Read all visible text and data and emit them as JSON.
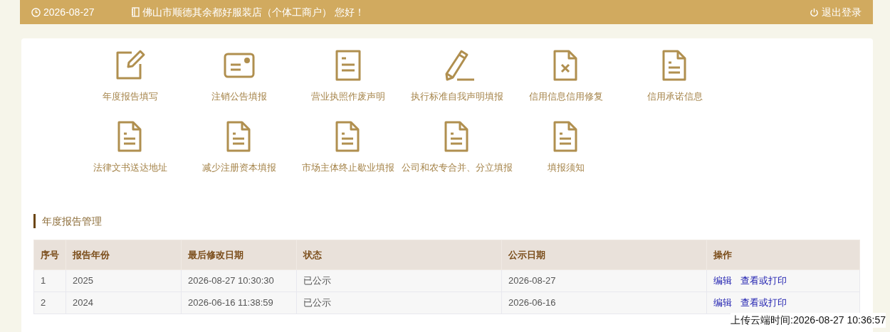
{
  "header": {
    "date": "2026-08-27",
    "greeting": "佛山市顺德其余都好服装店（个体工商户） 您好！",
    "logout": "退出登录"
  },
  "menu": [
    {
      "kind": "edit",
      "label": "年度报告填写"
    },
    {
      "kind": "card",
      "label": "注销公告填报"
    },
    {
      "kind": "doc",
      "label": "营业执照作废声明"
    },
    {
      "kind": "pencil",
      "label": "执行标准自我声明填报"
    },
    {
      "kind": "doc-x",
      "label": "信用信息信用修复"
    },
    {
      "kind": "file",
      "label": "信用承诺信息"
    },
    {
      "kind": "file",
      "label": "法律文书送达地址"
    },
    {
      "kind": "file",
      "label": "减少注册资本填报"
    },
    {
      "kind": "file",
      "label": "市场主体终止歇业填报"
    },
    {
      "kind": "file",
      "label": "公司和农专合并、分立填报"
    },
    {
      "kind": "file",
      "label": "填报须知"
    }
  ],
  "section_title": "年度报告管理",
  "table": {
    "columns": [
      "序号",
      "报告年份",
      "最后修改日期",
      "状态",
      "公示日期",
      "操作"
    ],
    "rows": [
      {
        "cells": [
          "1",
          "2025",
          "2026-08-27 10:30:30",
          "已公示",
          "2026-08-27"
        ],
        "actions": [
          "编辑",
          "查看或打印"
        ]
      },
      {
        "cells": [
          "2",
          "2024",
          "2026-06-16 11:38:59",
          "已公示",
          "2026-06-16"
        ],
        "actions": [
          "编辑",
          "查看或打印"
        ]
      }
    ]
  },
  "upload_time": "上传云端时间:2026-08-27 10:36:57"
}
